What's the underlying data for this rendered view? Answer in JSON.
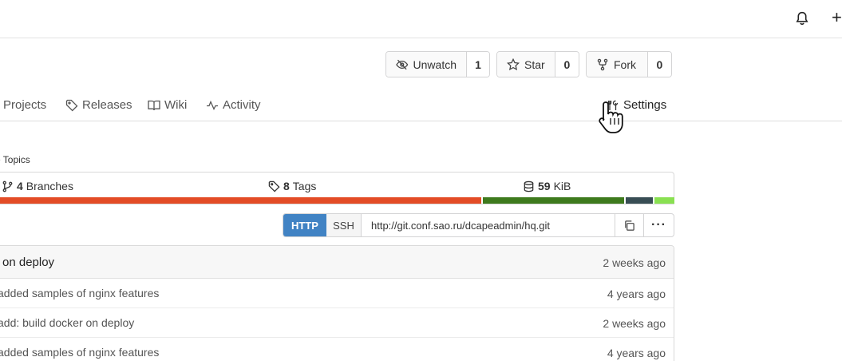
{
  "header": {
    "bell_icon": "bell-icon",
    "plus_label": "+"
  },
  "repo_actions": {
    "watch": {
      "label": "Unwatch",
      "count": "1"
    },
    "star": {
      "label": "Star",
      "count": "0"
    },
    "fork": {
      "label": "Fork",
      "count": "0"
    }
  },
  "tabs": [
    {
      "label": "Projects"
    },
    {
      "label": "Releases"
    },
    {
      "label": "Wiki"
    },
    {
      "label": "Activity"
    },
    {
      "label": "Settings"
    }
  ],
  "topics_label": "e Topics",
  "stats": {
    "branches_count": "4",
    "branches_label": "Branches",
    "tags_count": "8",
    "tags_label": "Tags",
    "size_value": "59",
    "size_unit": "KiB"
  },
  "language_bar_colors": [
    "#e34c26",
    "#3e7a1d",
    "#384d54",
    "#89e051"
  ],
  "language_bar_shares": [
    0.72,
    0.21,
    0.04,
    0.03
  ],
  "clone": {
    "http_label": "HTTP",
    "ssh_label": "SSH",
    "url": "http://git.conf.sao.ru/dcapeadmin/hq.git",
    "more_label": "···"
  },
  "latest_commit": {
    "message": "on deploy",
    "when": "2 weeks ago"
  },
  "files": [
    {
      "message": "added samples of nginx features",
      "when": "4 years ago"
    },
    {
      "message": "add: build docker on deploy",
      "when": "2 weeks ago"
    },
    {
      "message": "added samples of nginx features",
      "when": "4 years ago"
    }
  ]
}
